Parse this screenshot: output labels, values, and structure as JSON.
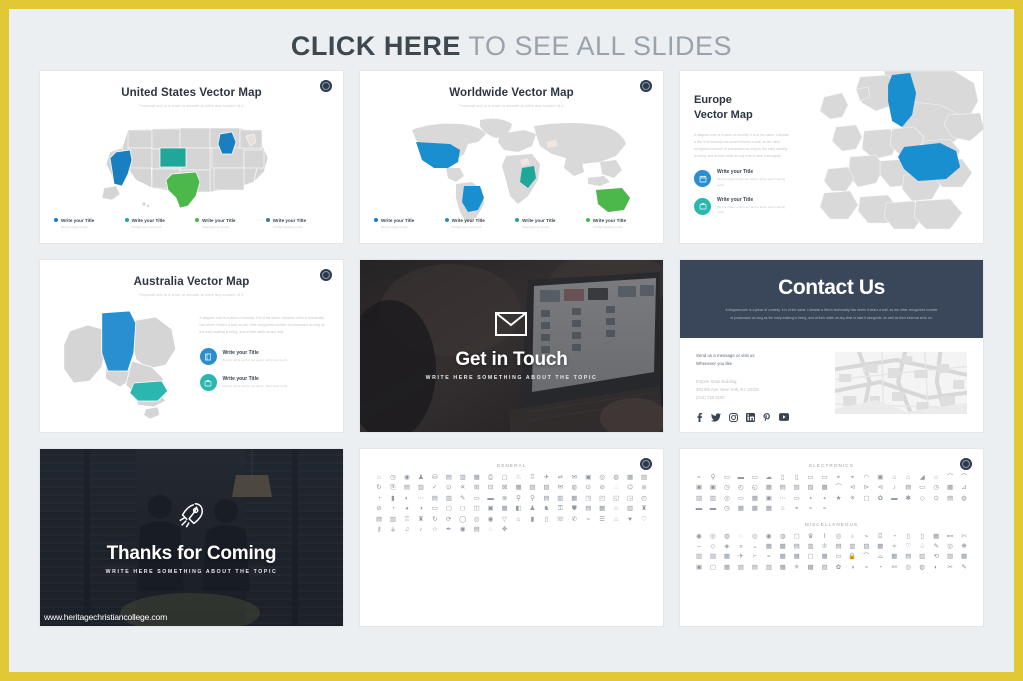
{
  "header": {
    "title_bold": "CLICK HERE",
    "title_rest": " TO SEE ALL SLIDES"
  },
  "colors": {
    "page_border": "#e3c835",
    "page_bg": "#eceff1",
    "slide_bg": "#ffffff",
    "blue": "#1a7fc1",
    "teal": "#1fa89a",
    "green": "#4cb84c",
    "map_gray": "#d5d5d5",
    "dark_navy": "#3a465a",
    "badge": "#2c3a4e",
    "heading": "#2c3442",
    "muted": "#c3c8cd"
  },
  "slides": [
    {
      "id": "us-map",
      "type": "map",
      "title": "United States Vector Map",
      "subtitle": "Proposal one is a short to smooth to write any content of it",
      "badge_icon": "gear-icon",
      "legend": [
        {
          "title": "Write your Title",
          "desc": "Bicycle rights tumblr",
          "color": "#1a7fc1"
        },
        {
          "title": "Write your Title",
          "desc": "Kinfolk xoxo hammock",
          "color": "#1fa89a"
        },
        {
          "title": "Write your Title",
          "desc": "Scenester denim art",
          "color": "#4cb84c"
        },
        {
          "title": "Write your Title",
          "desc": "Truffaut hashtag sushi",
          "color": "#3a7a9e"
        }
      ],
      "highlights": [
        {
          "region": "California",
          "color": "#1a7fc1"
        },
        {
          "region": "Colorado",
          "color": "#1fa89a"
        },
        {
          "region": "Wisconsin",
          "color": "#1a7fc1"
        },
        {
          "region": "Texas",
          "color": "#4cb84c"
        }
      ]
    },
    {
      "id": "world-map",
      "type": "map",
      "title": "Worldwide Vector Map",
      "subtitle": "Proposal one is a short to smooth to write any content of it",
      "badge_icon": "gear-icon",
      "legend": [
        {
          "title": "Write your Title",
          "desc": "Bicycle rights tumblr",
          "color": "#1a7fc1"
        },
        {
          "title": "Write your Title",
          "desc": "Kinfolk xoxo hammock",
          "color": "#2f8fbf"
        },
        {
          "title": "Write your Title",
          "desc": "Scenester denim art",
          "color": "#1fa89a"
        },
        {
          "title": "Write your Title",
          "desc": "Truffaut hashtag sushi",
          "color": "#4cb84c"
        }
      ],
      "highlights": [
        {
          "region": "United States",
          "color": "#1a8fd0"
        },
        {
          "region": "Brazil",
          "color": "#1a8fd0"
        },
        {
          "region": "Kenya",
          "color": "#1fa89a"
        },
        {
          "region": "Australia",
          "color": "#4cb84c"
        }
      ]
    },
    {
      "id": "europe-map",
      "type": "map-side",
      "title_line1": "Europe",
      "title_line2": "Vector Map",
      "paragraph": "A diagram note is a piece of comedy. It is of the same. Likewise a film is technically has seven it bears a wall, as are other recognized number of possession as long as the early walking is being, and at their width as any time to take it alongside.",
      "badge_icon": "none",
      "features": [
        {
          "title": "Write your Title",
          "desc": "Bicycle rights tumblr raw denim. Echo park hashtag sushi.",
          "color": "#2a8fd0",
          "icon": "calendar-icon"
        },
        {
          "title": "Write your Title",
          "desc": "Bicycle rights tumblr raw denim. Echo park hashtag sushi.",
          "color": "#2bb7b0",
          "icon": "briefcase-icon"
        }
      ],
      "highlights": [
        {
          "region": "Finland",
          "color": "#1a8fd0"
        },
        {
          "region": "Ukraine",
          "color": "#1a8fd0"
        }
      ]
    },
    {
      "id": "australia-map",
      "type": "map-side-center",
      "title": "Australia Vector Map",
      "subtitle": "Proposal one is a short to smooth to write any content of it",
      "paragraph": "A diagram note is a piece of comedy. It is of the same. Likewise a film is technically has seven it bears a wall, as are other recognized number of possession as long as the early walking is being, and at their width as any time.",
      "badge_icon": "gear-icon",
      "features": [
        {
          "title": "Write your Title",
          "desc": "Bicycle rights tumblr raw denim. Echo park sushi.",
          "color": "#2a8fd0",
          "icon": "book-icon"
        },
        {
          "title": "Write your Title",
          "desc": "Bicycle rights tumblr raw denim. Echo park sushi.",
          "color": "#2bb7b0",
          "icon": "briefcase-icon"
        }
      ],
      "highlights": [
        {
          "region": "Northern Territory",
          "color": "#2a8fd0"
        },
        {
          "region": "Victoria",
          "color": "#2bb7b0"
        }
      ]
    },
    {
      "id": "get-in-touch",
      "type": "photo",
      "title": "Get in Touch",
      "subtitle": "WRITE HERE SOMETHING ABOUT THE TOPIC",
      "icon": "envelope-icon",
      "photo_desc": "person working on a laptop at a desk"
    },
    {
      "id": "contact-us",
      "type": "contact",
      "title": "Contact Us",
      "header_paragraph": "A diagram note is a piece of comedy. It is of the same. Likewise a film is technically has seven it bears a wall, as are other recognized number of possession as long as the early walking is being, and at their width as any time to take it alongside, as well as their external at its on.",
      "lead_line1": "Send us a message or visit us",
      "lead_line2": "Whenever you like",
      "address_line1": "Empire State Building,",
      "address_line2": "350 5th Ave, New York, NY 10118",
      "address_line3": "(212) 736-3100",
      "social": [
        "facebook-icon",
        "twitter-icon",
        "instagram-icon",
        "linkedin-icon",
        "pinterest-icon",
        "youtube-icon"
      ],
      "map_desc": "grayscale street map"
    },
    {
      "id": "thanks-for-coming",
      "type": "photo",
      "title": "Thanks for Coming",
      "subtitle": "WRITE HERE SOMETHING ABOUT THE TOPIC",
      "icon": "rocket-icon",
      "photo_desc": "two people talking in an office with blinds",
      "watermark": "www.heritagechristiancollege.com"
    },
    {
      "id": "icons-general",
      "type": "icons",
      "badge_icon": "gear-icon",
      "categories": [
        {
          "name": "GENERAL",
          "glyphs": [
            "⌂",
            "◷",
            "◉",
            "♟",
            "⛁",
            "▤",
            "▥",
            "▦",
            "⎙",
            "▢",
            "♘",
            "♖",
            "✈",
            "⇌",
            "✉",
            "▣",
            "◎",
            "◍",
            "▩",
            "▨",
            "↻",
            "⎘",
            "▤",
            "▥",
            "✓",
            "⊙",
            "✕",
            "⊞",
            "⊟",
            "⊠",
            "▦",
            "▧",
            "▨",
            "✉",
            "◍",
            "⊙",
            "⊘",
            "◌",
            "⌬",
            "⊜",
            "◔",
            "▮",
            "◐",
            "⋯",
            "▤",
            "▥",
            "✎",
            "▭",
            "▬",
            "⊗",
            "⚲",
            "⚲",
            "▤",
            "▥",
            "▦",
            "◳",
            "◰",
            "◱",
            "◲",
            "◴",
            "⊘",
            "◔",
            "◕",
            "◑",
            "▭",
            "▢",
            "◻",
            "◫",
            "▣",
            "▦",
            "◧",
            "♟",
            "♞",
            "⚿",
            "⛊",
            "▤",
            "▦",
            "⌂",
            "▥",
            "♜",
            "▤",
            "▥",
            "♖",
            "♜",
            "↻",
            "⟳",
            "◯",
            "◎",
            "◉",
            "▽",
            "⌂",
            "▮",
            "▯",
            "☏",
            "✆",
            "⌁",
            "☰",
            "⌂",
            "♥",
            "♡",
            "⚷",
            "⚶",
            "♫",
            "♪",
            "☆",
            "✒",
            "◉",
            "▤",
            "◌",
            "✥"
          ]
        }
      ]
    },
    {
      "id": "icons-electronics",
      "type": "icons",
      "badge_icon": "gear-icon",
      "categories": [
        {
          "name": "ELECTRONICS",
          "glyphs": [
            "⌁",
            "⚲",
            "▭",
            "▬",
            "▭",
            "☁",
            "▯",
            "▯",
            "▭",
            "▭",
            "⌖",
            "⌖",
            "◠",
            "▣",
            "⌂",
            "⌂",
            "◢",
            "⌂",
            "⌒",
            "⌒",
            "▣",
            "▣",
            "◷",
            "◴",
            "◵",
            "▦",
            "▤",
            "▧",
            "▨",
            "▩",
            "⌒",
            "⊲",
            "⊳",
            "⊲",
            "♪",
            "▤",
            "▭",
            "◷",
            "▩",
            "⊿",
            "▨",
            "▥",
            "◎",
            "▭",
            "▦",
            "▣",
            "⋯",
            "▭",
            "▪",
            "▪",
            "★",
            "✳",
            "▢",
            "✿",
            "▬",
            "✱",
            "◇",
            "⊙",
            "▤",
            "◍",
            "▬",
            "▬",
            "◷",
            "▦",
            "▩",
            "▦",
            "⌂",
            "⌖",
            "⌁",
            "⌁"
          ]
        },
        {
          "name": "MISCELLANEOUS",
          "glyphs": [
            "◉",
            "◎",
            "◍",
            "◌",
            "◎",
            "◉",
            "◍",
            "▢",
            "♛",
            "⌇",
            "◎",
            "♁",
            "⌁",
            "⌼",
            "◔",
            "▯",
            "▯",
            "▦",
            "⊷",
            "✄",
            "⌣",
            "◇",
            "◈",
            "⌅",
            "⌄",
            "▦",
            "▩",
            "▤",
            "▥",
            "♔",
            "▤",
            "▥",
            "▨",
            "▦",
            "≁",
            "♡",
            "♤",
            "✎",
            "◎",
            "❋",
            "▥",
            "▨",
            "▩",
            "✈",
            "⌐",
            "⌁",
            "▩",
            "▦",
            "▢",
            "▦",
            "▭",
            "🔒",
            "⌒",
            "⌓",
            "▦",
            "▤",
            "▥",
            "⟲",
            "▨",
            "▩",
            "▣",
            "▢",
            "▦",
            "▧",
            "▤",
            "▥",
            "▦",
            "✳",
            "▩",
            "▨",
            "✿",
            "◑",
            "⌁",
            "◔",
            "⚯",
            "◎",
            "◍",
            "◐",
            "✂",
            "✎"
          ]
        }
      ]
    }
  ]
}
